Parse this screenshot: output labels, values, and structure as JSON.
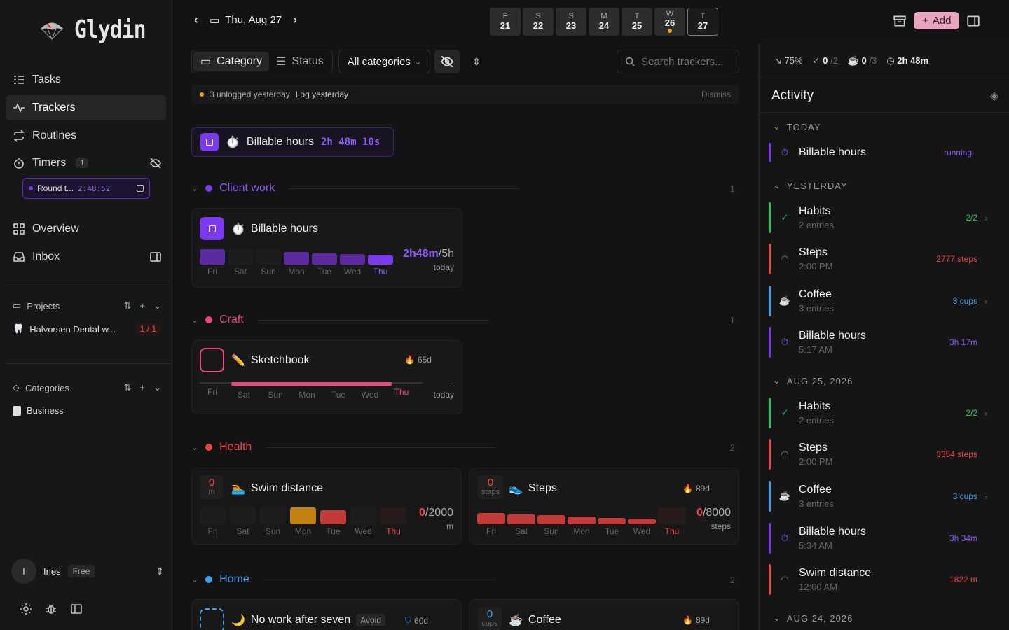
{
  "app": {
    "name": "Glydin"
  },
  "nav": {
    "tasks": "Tasks",
    "trackers": "Trackers",
    "routines": "Routines",
    "timers": "Timers",
    "timers_count": "1",
    "overview": "Overview",
    "inbox": "Inbox"
  },
  "timer_pill": {
    "label": "Round t...",
    "time": "2:48:52"
  },
  "projects": {
    "heading": "Projects",
    "items": [
      {
        "name": "Halvorsen Dental w...",
        "progress": "1 / 1"
      }
    ]
  },
  "categories": {
    "heading": "Categories",
    "items": [
      {
        "name": "Business"
      }
    ]
  },
  "user": {
    "name": "Ines",
    "initial": "I",
    "plan": "Free"
  },
  "header": {
    "date": "Thu, Aug 27",
    "days": [
      {
        "letter": "F",
        "num": "21"
      },
      {
        "letter": "S",
        "num": "22"
      },
      {
        "letter": "S",
        "num": "23"
      },
      {
        "letter": "M",
        "num": "24"
      },
      {
        "letter": "T",
        "num": "25"
      },
      {
        "letter": "W",
        "num": "26"
      },
      {
        "letter": "T",
        "num": "27"
      }
    ],
    "add_label": "Add"
  },
  "filters": {
    "category": "Category",
    "status": "Status",
    "all_categories": "All categories",
    "search_placeholder": "Search trackers..."
  },
  "notice": {
    "text": "3 unlogged yesterday",
    "action": "Log yesterday",
    "dismiss": "Dismiss"
  },
  "running": {
    "name": "Billable hours",
    "elapsed": "2h 48m 10s"
  },
  "groups": {
    "client": {
      "name": "Client work",
      "count": "1",
      "color": "#7c3aed"
    },
    "craft": {
      "name": "Craft",
      "count": "1",
      "color": "#e8467f"
    },
    "health": {
      "name": "Health",
      "count": "2",
      "color": "#ef4444"
    },
    "home": {
      "name": "Home",
      "count": "2",
      "color": "#3aa0f0"
    }
  },
  "weekday_labels": [
    "Fri",
    "Sat",
    "Sun",
    "Mon",
    "Tue",
    "Wed",
    "Thu"
  ],
  "cards": {
    "billable": {
      "name": "Billable hours",
      "value": "2h48m",
      "target": "/5h",
      "when": "today"
    },
    "sketchbook": {
      "name": "Sketchbook",
      "streak": "65d",
      "value": "-",
      "when": "today"
    },
    "swim": {
      "name": "Swim distance",
      "counter": "0",
      "unit": "m",
      "value": "0",
      "target": "/2000",
      "value_unit": "m"
    },
    "steps": {
      "name": "Steps",
      "counter": "0",
      "unit": "steps",
      "streak": "89d",
      "value": "0",
      "target": "/8000",
      "value_unit": "steps"
    },
    "nowork": {
      "name": "No work after seven",
      "tag": "Avoid",
      "streak": "60d"
    },
    "coffee": {
      "name": "Coffee",
      "counter": "0",
      "unit": "cups",
      "streak": "89d"
    }
  },
  "stats": {
    "trend": "75%",
    "done": "0",
    "done_of": "/2",
    "coffee": "0",
    "coffee_of": "/3",
    "time": "2h 48m"
  },
  "activity": {
    "title": "Activity",
    "today_label": "TODAY",
    "yesterday_label": "YESTERDAY",
    "aug25_label": "AUG 25, 2026",
    "aug24_label": "AUG 24, 2026",
    "today": [
      {
        "name": "Billable hours",
        "value": "running"
      }
    ],
    "yesterday": [
      {
        "name": "Habits",
        "sub": "2 entries",
        "value": "2/2"
      },
      {
        "name": "Steps",
        "sub": "2:00 PM",
        "value": "2777 steps"
      },
      {
        "name": "Coffee",
        "sub": "3 entries",
        "value": "3 cups"
      },
      {
        "name": "Billable hours",
        "sub": "5:17 AM",
        "value": "3h 17m"
      }
    ],
    "aug25": [
      {
        "name": "Habits",
        "sub": "2 entries",
        "value": "2/2"
      },
      {
        "name": "Steps",
        "sub": "2:00 PM",
        "value": "3354 steps"
      },
      {
        "name": "Coffee",
        "sub": "3 entries",
        "value": "3 cups"
      },
      {
        "name": "Billable hours",
        "sub": "5:34 AM",
        "value": "3h 34m"
      },
      {
        "name": "Swim distance",
        "sub": "12:00 AM",
        "value": "1822 m"
      }
    ]
  }
}
